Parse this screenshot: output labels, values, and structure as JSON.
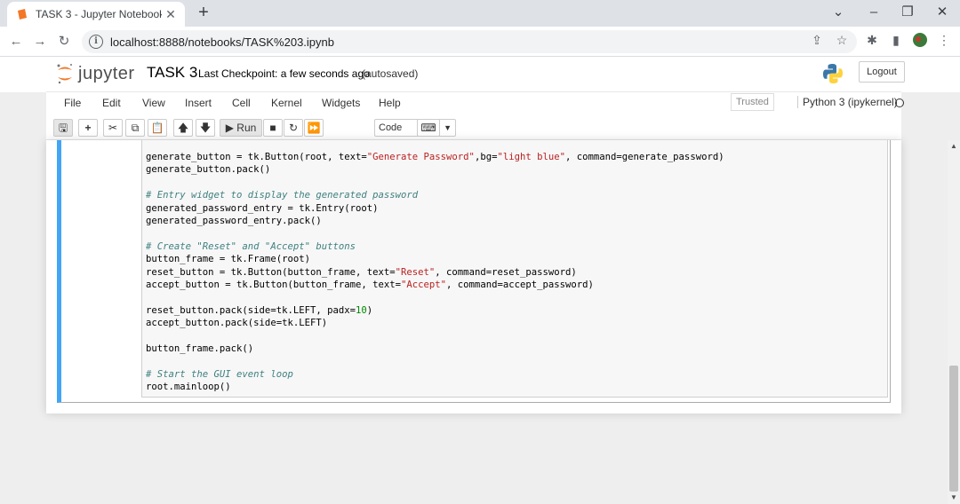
{
  "browser": {
    "tab_title": "TASK 3 - Jupyter Notebook",
    "url": "localhost:8888/notebooks/TASK%203.ipynb"
  },
  "header": {
    "logo_text": "jupyter",
    "notebook_name": "TASK 3",
    "checkpoint": "Last Checkpoint: a few seconds ago",
    "autosave": "(autosaved)",
    "logout_label": "Logout"
  },
  "menu": {
    "items": [
      "File",
      "Edit",
      "View",
      "Insert",
      "Cell",
      "Kernel",
      "Widgets",
      "Help"
    ],
    "trusted": "Trusted",
    "kernel": "Python 3 (ipykernel)"
  },
  "toolbar": {
    "run_label": "Run",
    "cell_type": "Code"
  },
  "code_lines": [
    [
      {
        "t": "generate_button = tk.Button(root, text=",
        "c": ""
      },
      {
        "t": "\"Generate Password\"",
        "c": "str"
      },
      {
        "t": ",bg=",
        "c": ""
      },
      {
        "t": "\"light blue\"",
        "c": "str"
      },
      {
        "t": ", command=generate_password)",
        "c": ""
      }
    ],
    [
      {
        "t": "generate_button.pack()",
        "c": ""
      }
    ],
    [],
    [
      {
        "t": "# Entry widget to display the generated password",
        "c": "com"
      }
    ],
    [
      {
        "t": "generated_password_entry = tk.Entry(root)",
        "c": ""
      }
    ],
    [
      {
        "t": "generated_password_entry.pack()",
        "c": ""
      }
    ],
    [],
    [
      {
        "t": "# Create \"Reset\" and \"Accept\" buttons",
        "c": "com"
      }
    ],
    [
      {
        "t": "button_frame = tk.Frame(root)",
        "c": ""
      }
    ],
    [
      {
        "t": "reset_button = tk.Button(button_frame, text=",
        "c": ""
      },
      {
        "t": "\"Reset\"",
        "c": "str"
      },
      {
        "t": ", command=reset_password)",
        "c": ""
      }
    ],
    [
      {
        "t": "accept_button = tk.Button(button_frame, text=",
        "c": ""
      },
      {
        "t": "\"Accept\"",
        "c": "str"
      },
      {
        "t": ", command=accept_password)",
        "c": ""
      }
    ],
    [],
    [
      {
        "t": "reset_button.pack(side=tk.LEFT, padx=",
        "c": ""
      },
      {
        "t": "10",
        "c": "num"
      },
      {
        "t": ")",
        "c": ""
      }
    ],
    [
      {
        "t": "accept_button.pack(side=tk.LEFT)",
        "c": ""
      }
    ],
    [],
    [
      {
        "t": "button_frame.pack()",
        "c": ""
      }
    ],
    [],
    [
      {
        "t": "# Start the GUI event loop",
        "c": "com"
      }
    ],
    [
      {
        "t": "root.mainloop()",
        "c": ""
      }
    ]
  ]
}
